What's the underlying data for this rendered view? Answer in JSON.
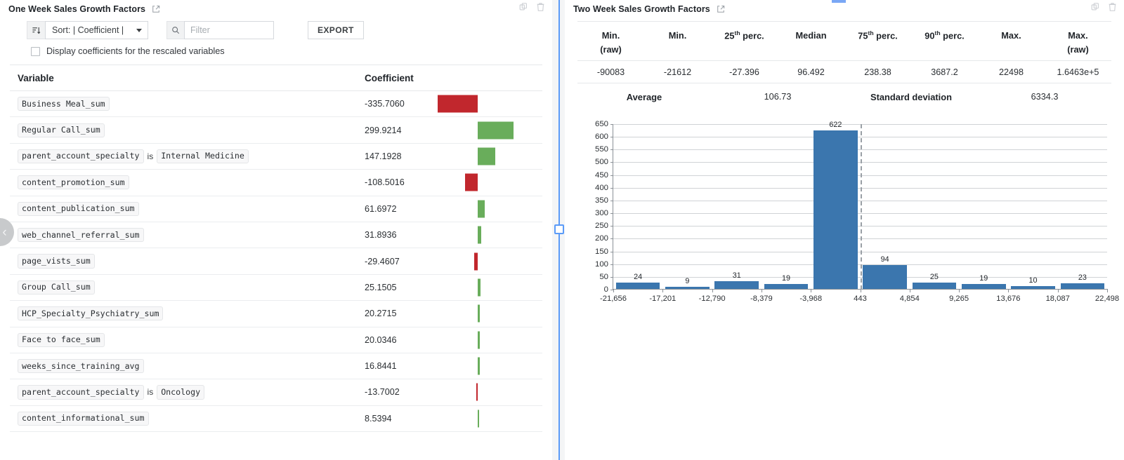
{
  "left": {
    "title": "One Week Sales Growth Factors",
    "popout_icon": "external-link-icon",
    "copy_icon": "copy-icon",
    "delete_icon": "trash-icon",
    "toolbar": {
      "sort_icon": "sort-icon",
      "sort_value": "Sort: | Coefficient |",
      "search_icon": "search-icon",
      "filter_value": "",
      "filter_placeholder": "Filter",
      "export_label": "EXPORT"
    },
    "checkbox": {
      "checked": false,
      "label": "Display coefficients for the rescaled variables"
    },
    "columns": {
      "variable": "Variable",
      "coefficient": "Coefficient"
    },
    "collapse_icon": "chevron-left-icon",
    "rows": [
      {
        "chips": [
          "Business Meal_sum"
        ],
        "connector": "",
        "coefficient": "-335.7060",
        "value": -335.706
      },
      {
        "chips": [
          "Regular Call_sum"
        ],
        "connector": "",
        "coefficient": "299.9214",
        "value": 299.9214
      },
      {
        "chips": [
          "parent_account_specialty",
          "Internal Medicine"
        ],
        "connector": "is",
        "coefficient": "147.1928",
        "value": 147.1928
      },
      {
        "chips": [
          "content_promotion_sum"
        ],
        "connector": "",
        "coefficient": "-108.5016",
        "value": -108.5016
      },
      {
        "chips": [
          "content_publication_sum"
        ],
        "connector": "",
        "coefficient": "61.6972",
        "value": 61.6972
      },
      {
        "chips": [
          "web_channel_referral_sum"
        ],
        "connector": "",
        "coefficient": "31.8936",
        "value": 31.8936
      },
      {
        "chips": [
          "page_vists_sum"
        ],
        "connector": "",
        "coefficient": "-29.4607",
        "value": -29.4607
      },
      {
        "chips": [
          "Group Call_sum"
        ],
        "connector": "",
        "coefficient": "25.1505",
        "value": 25.1505
      },
      {
        "chips": [
          "HCP_Specialty_Psychiatry_sum"
        ],
        "connector": "",
        "coefficient": "20.2715",
        "value": 20.2715
      },
      {
        "chips": [
          "Face to face_sum"
        ],
        "connector": "",
        "coefficient": "20.0346",
        "value": 20.0346
      },
      {
        "chips": [
          "weeks_since_training_avg"
        ],
        "connector": "",
        "coefficient": "16.8441",
        "value": 16.8441
      },
      {
        "chips": [
          "parent_account_specialty",
          "Oncology"
        ],
        "connector": "is",
        "coefficient": "-13.7002",
        "value": -13.7002
      },
      {
        "chips": [
          "content_informational_sum"
        ],
        "connector": "",
        "coefficient": "8.5394",
        "value": 8.5394
      }
    ],
    "bar_colors": {
      "negative": "#c1272d",
      "positive": "#69ad5b"
    }
  },
  "splitter": {
    "handle_icon": "resize-handle-icon",
    "color": "#5b9bf8"
  },
  "right": {
    "title": "Two Week Sales Growth Factors",
    "popout_icon": "external-link-icon",
    "copy_icon": "copy-icon",
    "delete_icon": "trash-icon",
    "stats": {
      "headers": [
        {
          "main": "Min.",
          "sup": "",
          "sub": "(raw)"
        },
        {
          "main": "Min.",
          "sup": "",
          "sub": ""
        },
        {
          "main": "25",
          "sup": "th",
          "after": " perc.",
          "sub": ""
        },
        {
          "main": "Median",
          "sup": "",
          "sub": ""
        },
        {
          "main": "75",
          "sup": "th",
          "after": " perc.",
          "sub": ""
        },
        {
          "main": "90",
          "sup": "th",
          "after": " perc.",
          "sub": ""
        },
        {
          "main": "Max.",
          "sup": "",
          "sub": ""
        },
        {
          "main": "Max.",
          "sup": "",
          "sub": "(raw)"
        }
      ],
      "values": [
        "-90083",
        "-21612",
        "-27.396",
        "96.492",
        "238.38",
        "3687.2",
        "22498",
        "1.6463e+5"
      ],
      "average_label": "Average",
      "average_value": "106.73",
      "stddev_label": "Standard deviation",
      "stddev_value": "6334.3"
    }
  },
  "chart_data": {
    "type": "bar",
    "title": "",
    "xlabel": "",
    "ylabel": "",
    "ylim": [
      0,
      650
    ],
    "yticks": [
      0,
      50,
      100,
      150,
      200,
      250,
      300,
      350,
      400,
      450,
      500,
      550,
      600,
      650
    ],
    "grid": true,
    "legend": "none",
    "bar_color": "#3b76ae",
    "xticks": [
      "-21,656",
      "-17,201",
      "-12,790",
      "-8,379",
      "-3,968",
      "443",
      "4,854",
      "9,265",
      "13,676",
      "18,087",
      "22,498"
    ],
    "xtick_values": [
      -21656,
      -17201,
      -12790,
      -8379,
      -3968,
      443,
      4854,
      9265,
      13676,
      18087,
      22498
    ],
    "mean_marker": 443,
    "categories": [
      "-21,656",
      "-17,201",
      "-12,790",
      "-8,379",
      "-3,968",
      "443",
      "4,854",
      "9,265",
      "13,676",
      "18,087"
    ],
    "values": [
      24,
      9,
      31,
      19,
      622,
      94,
      25,
      19,
      10,
      23
    ],
    "bar_labels": [
      "24",
      "9",
      "31",
      "19",
      "622",
      "94",
      "25",
      "19",
      "10",
      "23"
    ]
  }
}
